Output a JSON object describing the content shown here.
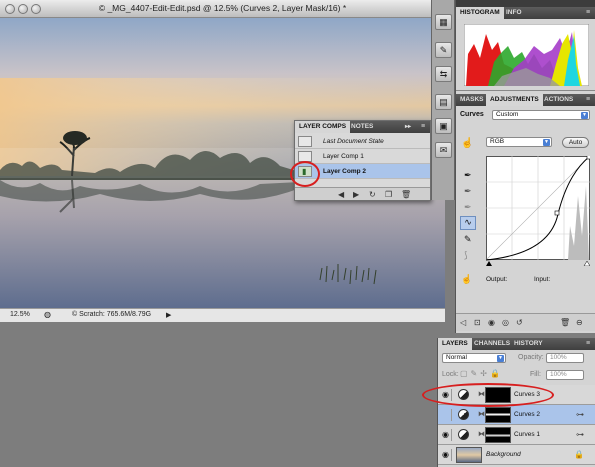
{
  "document": {
    "title": "© _MG_4407-Edit-Edit.psd @ 12.5% (Curves 2, Layer Mask/16) *",
    "zoom": "12.5%",
    "scratch": "© Scratch: 765.6M/8.79G"
  },
  "layer_comps": {
    "tabs": [
      "LAYER COMPS",
      "NOTES"
    ],
    "rows": [
      {
        "label": "Last Document State",
        "italic": true
      },
      {
        "label": "Layer Comp 1",
        "italic": false
      },
      {
        "label": "Layer Comp 2",
        "italic": false,
        "selected": true
      }
    ]
  },
  "histogram": {
    "tabs": [
      "HISTOGRAM",
      "INFO"
    ]
  },
  "adjustments": {
    "tabs": [
      "MASKS",
      "ADJUSTMENTS",
      "ACTIONS"
    ],
    "type_label": "Curves",
    "preset": "Custom",
    "channel": "RGB",
    "auto_label": "Auto",
    "output_label": "Output:",
    "input_label": "Input:"
  },
  "layers": {
    "tabs": [
      "LAYERS",
      "CHANNELS",
      "HISTORY"
    ],
    "blend_mode": "Normal",
    "opacity_label": "Opacity:",
    "opacity_value": "100%",
    "lock_label": "Lock:",
    "fill_label": "Fill:",
    "fill_value": "100%",
    "rows": [
      {
        "name": "Curves 3",
        "italic": false,
        "selected": false
      },
      {
        "name": "Curves 2",
        "italic": false,
        "selected": true
      },
      {
        "name": "Curves 1",
        "italic": false,
        "selected": false
      },
      {
        "name": "Background",
        "italic": true,
        "selected": false
      }
    ]
  },
  "colors": {
    "annotation_red": "#d71f1f",
    "selection_blue": "#aac4ea",
    "panel_gray": "#d4d4d4",
    "app_background": "#7d7d7d"
  },
  "icons": [
    "histogram-icon",
    "info-icon",
    "eyedropper-icon",
    "curve-tool-icon",
    "pencil-icon",
    "eye-icon",
    "link-icon",
    "trash-icon",
    "new-layer-icon",
    "adjustment-layer-icon"
  ]
}
